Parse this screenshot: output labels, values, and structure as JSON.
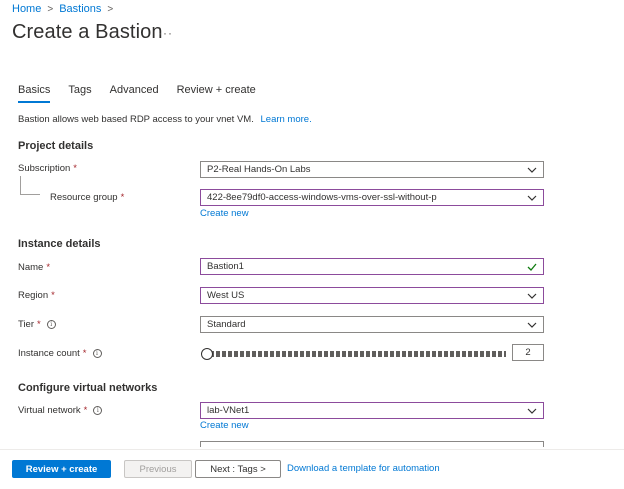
{
  "breadcrumb": {
    "home": "Home",
    "bastions": "Bastions",
    "separator": ">"
  },
  "page": {
    "title": "Create a Bastion",
    "more": "···"
  },
  "tabs": [
    {
      "label": "Basics",
      "active": true
    },
    {
      "label": "Tags",
      "active": false
    },
    {
      "label": "Advanced",
      "active": false
    },
    {
      "label": "Review + create",
      "active": false
    }
  ],
  "intro": {
    "text": "Bastion allows web based RDP access to your vnet VM.",
    "link": "Learn more."
  },
  "project": {
    "title": "Project details",
    "subscription_label": "Subscription",
    "subscription_value": "P2-Real Hands-On Labs",
    "resource_group_label": "Resource group",
    "resource_group_value": "422-8ee79df0-access-windows-vms-over-ssl-without-p",
    "create_new": "Create new"
  },
  "instance": {
    "title": "Instance details",
    "name_label": "Name",
    "name_value": "Bastion1",
    "region_label": "Region",
    "region_value": "West US",
    "tier_label": "Tier",
    "tier_value": "Standard",
    "count_label": "Instance count",
    "count_value": "2",
    "count_fraction": 0.0
  },
  "network": {
    "title": "Configure virtual networks",
    "vnet_label": "Virtual network",
    "vnet_value": "lab-VNet1",
    "create_new": "Create new"
  },
  "required_marker": "*",
  "info_glyph": "i",
  "footer": {
    "review_create": "Review + create",
    "previous": "Previous",
    "next": "Next : Tags >",
    "download": "Download a template for automation"
  },
  "colors": {
    "accent": "#0078d4",
    "focus_border": "#8c4b9c",
    "required": "#a4262c",
    "valid_check": "#107c10"
  }
}
